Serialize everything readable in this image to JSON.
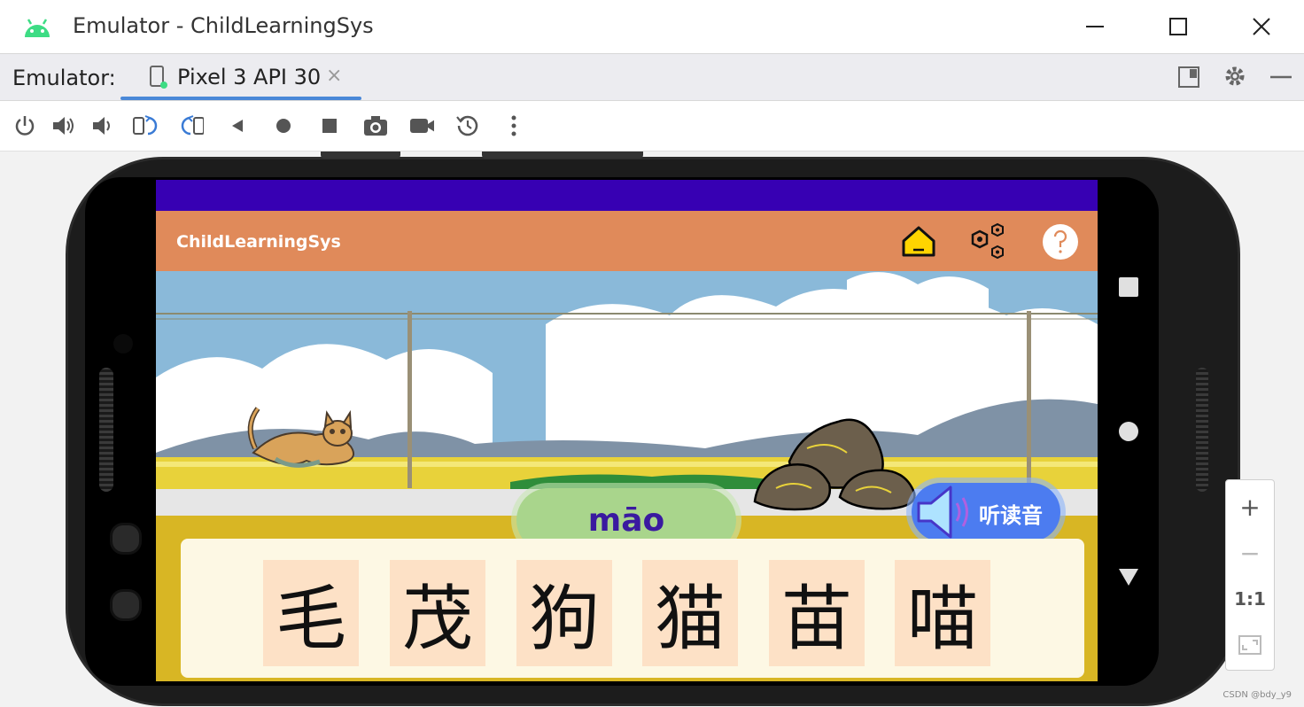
{
  "window": {
    "title": "Emulator - ChildLearningSys",
    "minimize_icon": "minimize-icon",
    "maximize_icon": "maximize-icon",
    "close_icon": "close-icon"
  },
  "tabs": {
    "prefix_label": "Emulator:",
    "items": [
      {
        "label": "Pixel 3 API 30",
        "close": "×",
        "active": true
      }
    ]
  },
  "toolbar": {
    "items": [
      "power-icon",
      "volume-up-icon",
      "volume-down-icon",
      "rotate-left-icon",
      "rotate-right-icon",
      "back-icon",
      "home-icon",
      "overview-icon",
      "screenshot-icon",
      "screen-record-icon",
      "snapshot-icon",
      "more-icon"
    ]
  },
  "app": {
    "title": "ChildLearningSys",
    "status_bar_color": "#3700b3",
    "app_bar_color": "#e08a5a",
    "pinyin": "māo",
    "listen_label": "听读音",
    "characters": [
      "毛",
      "茂",
      "狗",
      "猫",
      "苗",
      "喵"
    ]
  },
  "zoom": {
    "plus": "+",
    "minus": "−",
    "one_to_one": "1:1"
  },
  "watermark": "CSDN @bdy_y9"
}
